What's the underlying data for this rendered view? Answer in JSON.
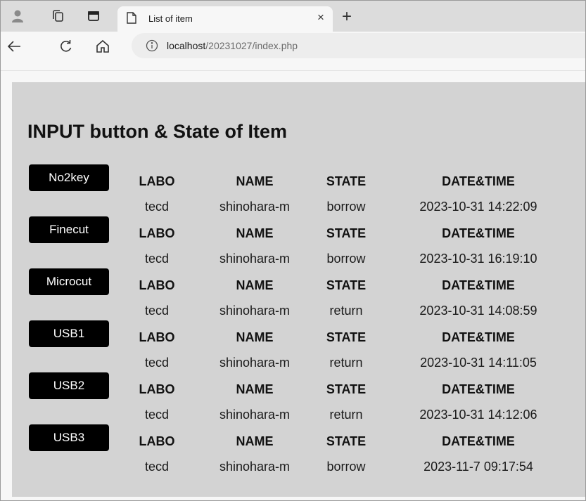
{
  "browser": {
    "tab_title": "List of item",
    "tab_close": "×",
    "new_tab": "+",
    "url_host": "localhost",
    "url_path": "/20231027/index.php"
  },
  "page": {
    "heading": "INPUT button & State of Item",
    "headers": {
      "labo": "LABO",
      "name": "NAME",
      "state": "STATE",
      "datetime": "DATE&TIME"
    },
    "items": [
      {
        "button": "No2key",
        "labo": "tecd",
        "name": "shinohara-m",
        "state": "borrow",
        "datetime": "2023-10-31 14:22:09"
      },
      {
        "button": "Finecut",
        "labo": "tecd",
        "name": "shinohara-m",
        "state": "borrow",
        "datetime": "2023-10-31 16:19:10"
      },
      {
        "button": "Microcut",
        "labo": "tecd",
        "name": "shinohara-m",
        "state": "return",
        "datetime": "2023-10-31 14:08:59"
      },
      {
        "button": "USB1",
        "labo": "tecd",
        "name": "shinohara-m",
        "state": "return",
        "datetime": "2023-10-31 14:11:05"
      },
      {
        "button": "USB2",
        "labo": "tecd",
        "name": "shinohara-m",
        "state": "return",
        "datetime": "2023-10-31 14:12:06"
      },
      {
        "button": "USB3",
        "labo": "tecd",
        "name": "shinohara-m",
        "state": "borrow",
        "datetime": "2023-11-7 09:17:54"
      }
    ]
  },
  "icons": {
    "profile": "profile-icon",
    "workspaces": "workspaces-icon",
    "tab_actions": "tab-actions-icon",
    "page": "page-icon",
    "back": "back-arrow-icon",
    "refresh": "refresh-icon",
    "home": "home-icon",
    "info": "info-icon"
  },
  "colors": {
    "button_bg": "#000000",
    "page_bg": "#d3d3d3",
    "tabstrip_bg": "#dcdcdc"
  }
}
